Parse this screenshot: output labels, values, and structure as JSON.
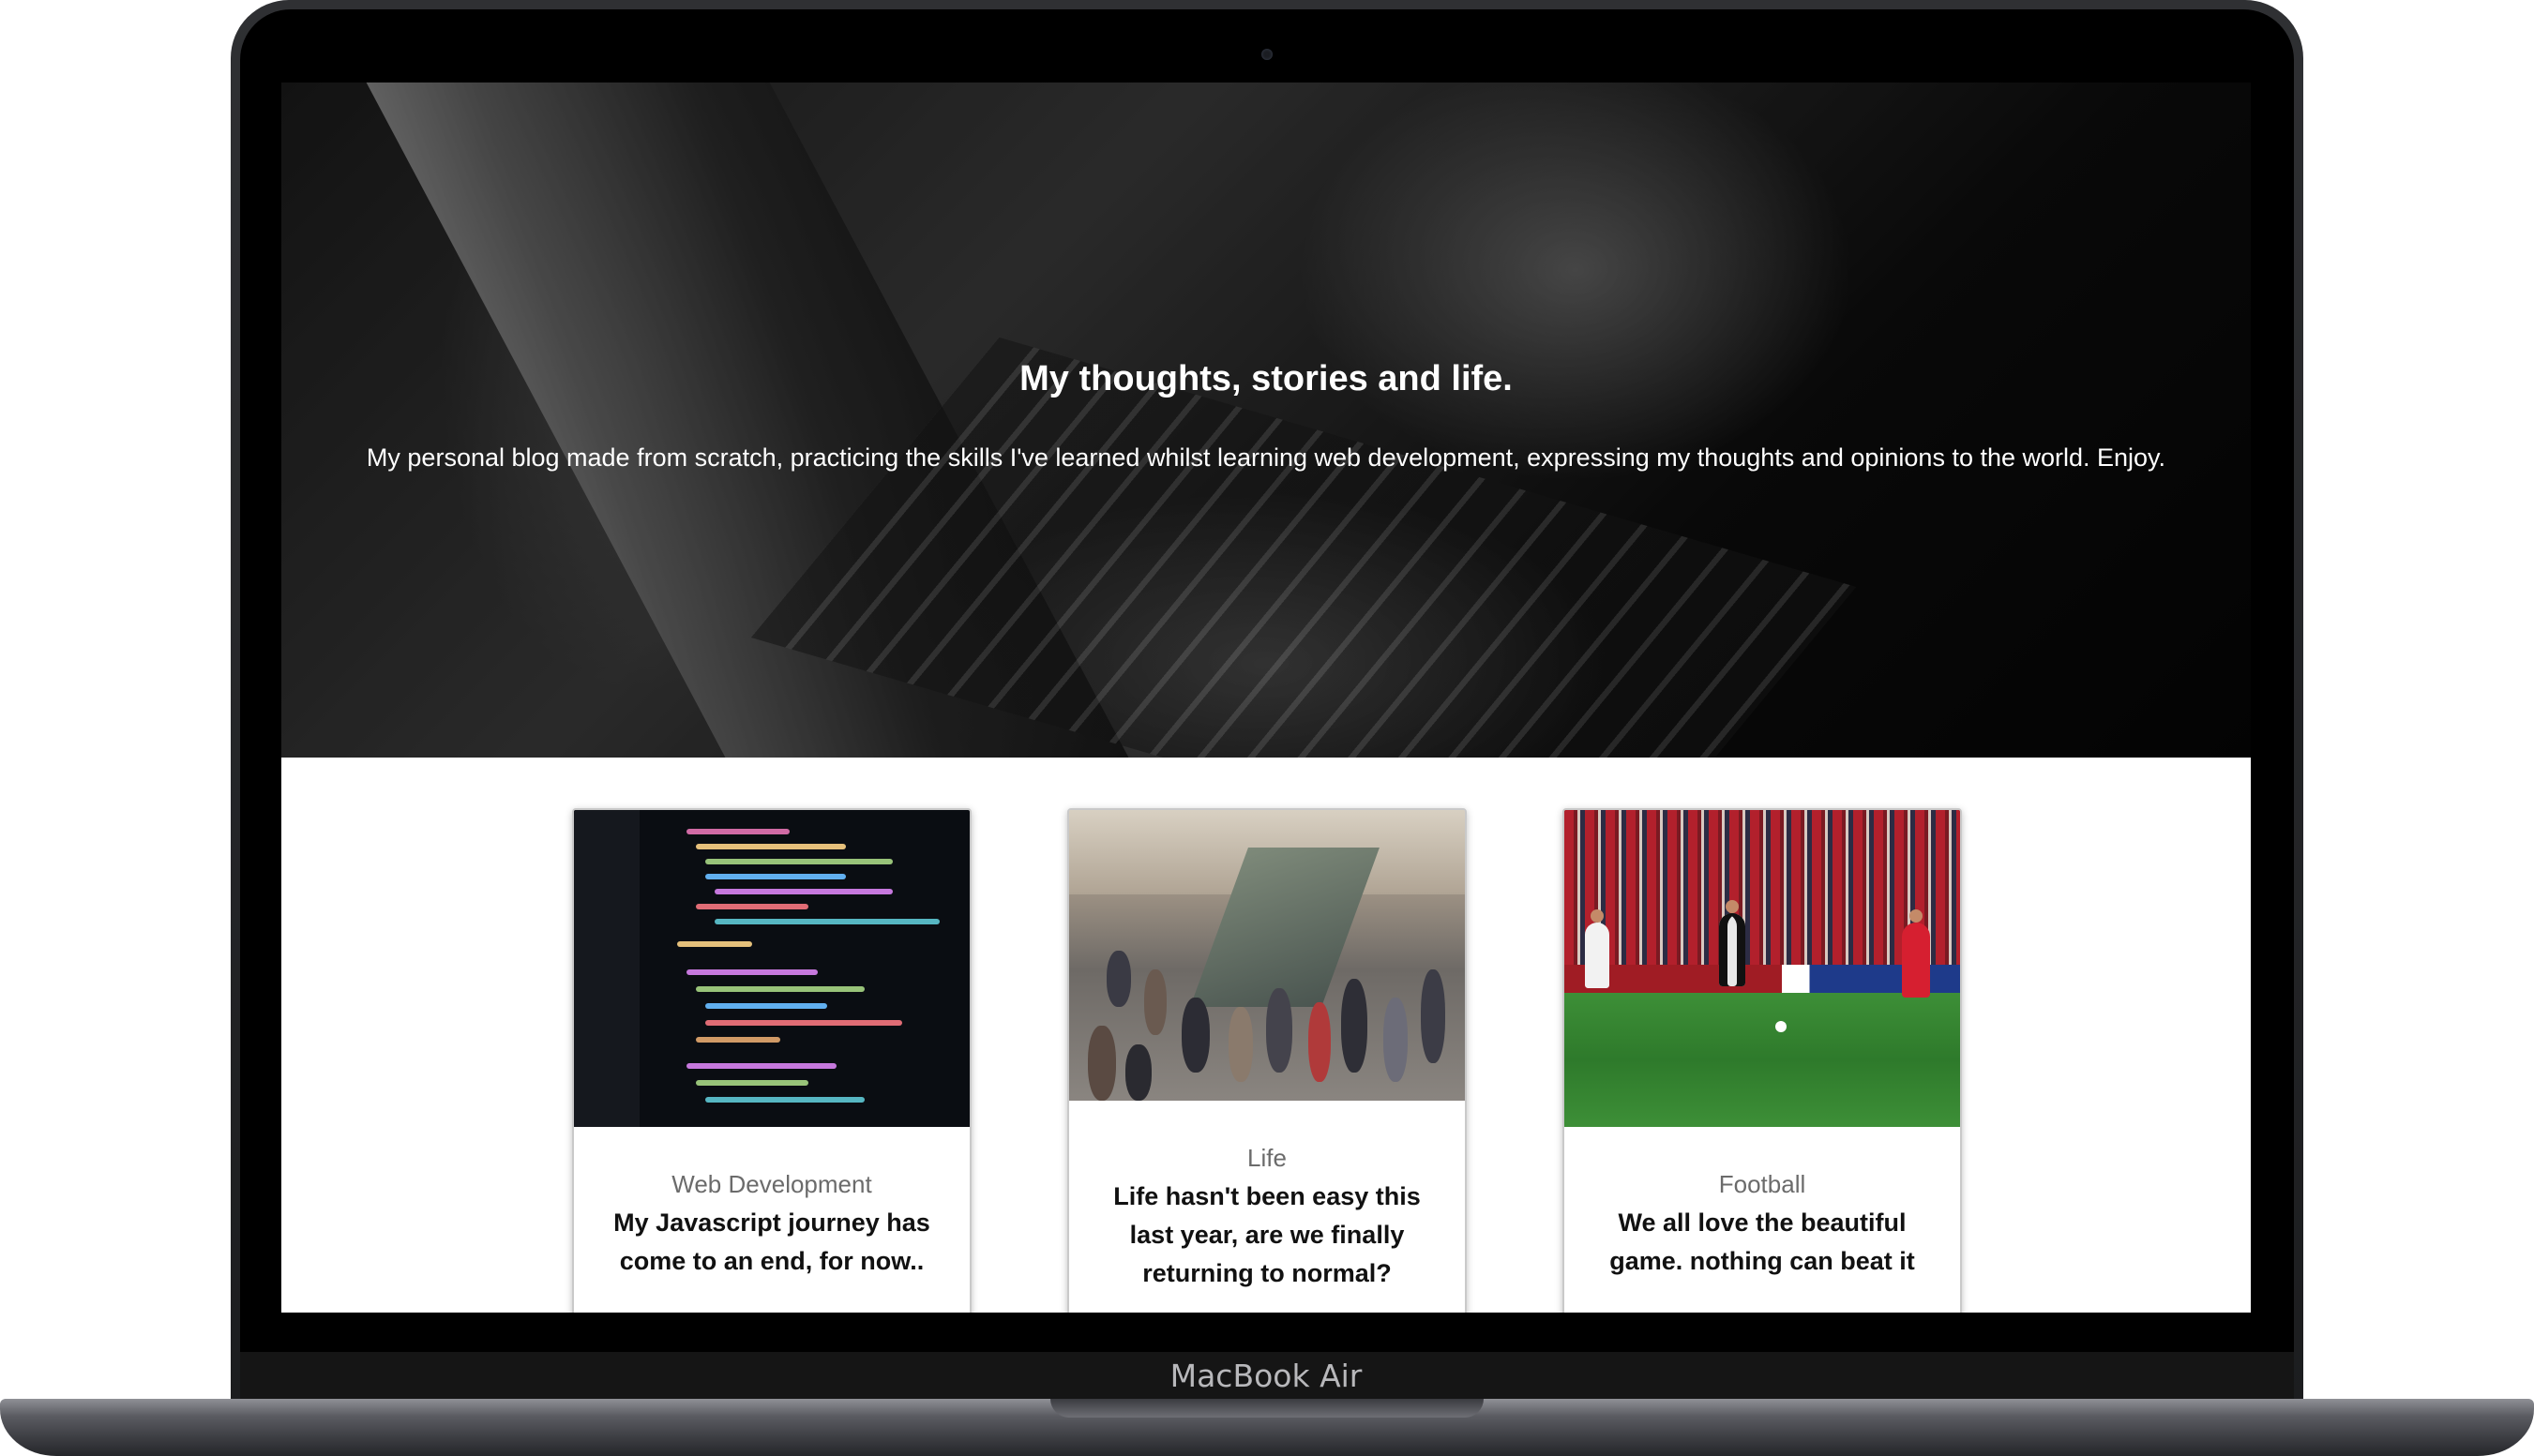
{
  "hero": {
    "title": "My thoughts, stories and life.",
    "subtitle": "My personal blog made from scratch, practicing the skills I've learned whilst learning web development, expressing my thoughts and opinions to the world. Enjoy."
  },
  "posts": [
    {
      "category": "Web Development",
      "title": "My Javascript journey has come to an end, for now..",
      "image": "code-editor-image"
    },
    {
      "category": "Life",
      "title": "Life hasn't been easy this last year, are we finally returning to normal?",
      "image": "busy-station-crowd-image"
    },
    {
      "category": "Football",
      "title": "We all love the beautiful game. nothing can beat it",
      "image": "football-match-image"
    }
  ],
  "device": {
    "label": "MacBook Air"
  },
  "colors": {
    "hero_text": "#ffffff",
    "category_text": "#6b6b6b",
    "title_text": "#111111",
    "device_shell": "#1c1d1f"
  }
}
